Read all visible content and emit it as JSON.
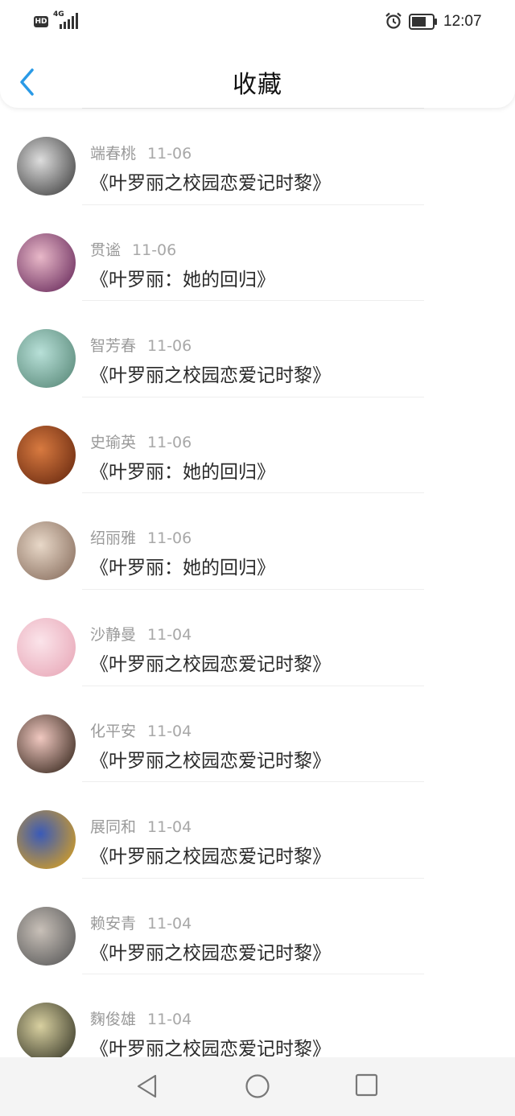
{
  "status_bar": {
    "hd": "HD",
    "network": "4G",
    "time": "12:07"
  },
  "header": {
    "title": "收藏",
    "back_icon": "chevron-left-icon",
    "accent": "#2a9ae6"
  },
  "favorites": [
    {
      "user": "端春桃",
      "date": "11-06",
      "book": "《叶罗丽之校园恋爱记时黎》",
      "avatar_colors": [
        "#444",
        "#ddd"
      ]
    },
    {
      "user": "贯谧",
      "date": "11-06",
      "book": "《叶罗丽：她的回归》",
      "avatar_colors": [
        "#6b2d5e",
        "#e8b8c8"
      ]
    },
    {
      "user": "智芳春",
      "date": "11-06",
      "book": "《叶罗丽之校园恋爱记时黎》",
      "avatar_colors": [
        "#5a8a7a",
        "#b8e0d8"
      ]
    },
    {
      "user": "史瑜英",
      "date": "11-06",
      "book": "《叶罗丽：她的回归》",
      "avatar_colors": [
        "#6a2a10",
        "#d87a40"
      ]
    },
    {
      "user": "绍丽雅",
      "date": "11-06",
      "book": "《叶罗丽：她的回归》",
      "avatar_colors": [
        "#8a7060",
        "#e8d8c8"
      ]
    },
    {
      "user": "沙静曼",
      "date": "11-04",
      "book": "《叶罗丽之校园恋爱记时黎》",
      "avatar_colors": [
        "#e8a8b8",
        "#fbe4ea"
      ]
    },
    {
      "user": "化平安",
      "date": "11-04",
      "book": "《叶罗丽之校园恋爱记时黎》",
      "avatar_colors": [
        "#3a2a20",
        "#f0c8c0"
      ]
    },
    {
      "user": "展同和",
      "date": "11-04",
      "book": "《叶罗丽之校园恋爱记时黎》",
      "avatar_colors": [
        "#d8a020",
        "#3a5ab8"
      ]
    },
    {
      "user": "赖安青",
      "date": "11-04",
      "book": "《叶罗丽之校园恋爱记时黎》",
      "avatar_colors": [
        "#5a5a5a",
        "#c8c0b8"
      ]
    },
    {
      "user": "麴俊雄",
      "date": "11-04",
      "book": "《叶罗丽之校园恋爱记时黎》",
      "avatar_colors": [
        "#3a3a2a",
        "#d8d0a0"
      ]
    }
  ],
  "nav_bar": {
    "back_icon": "triangle-back-icon",
    "home_icon": "circle-home-icon",
    "recents_icon": "square-recents-icon"
  }
}
